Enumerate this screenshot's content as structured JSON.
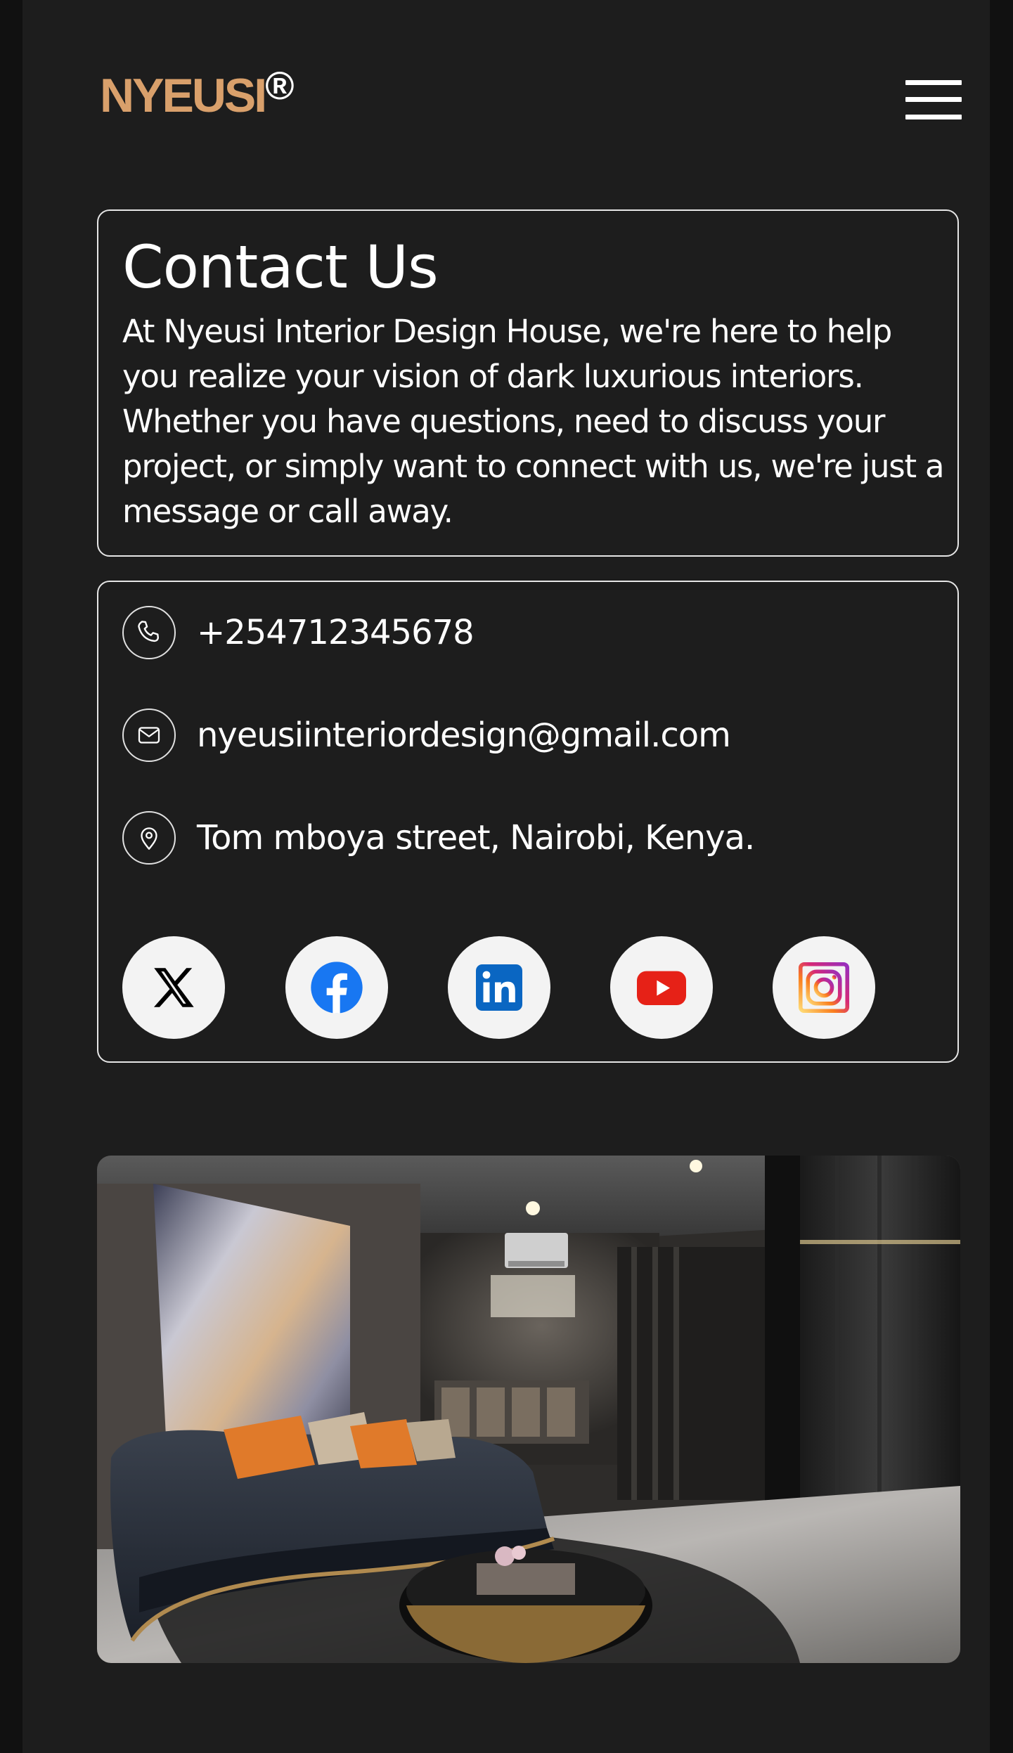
{
  "header": {
    "logo_text": "NYEUSI",
    "logo_mark": "®",
    "logo_color": "#d9a06b",
    "menu_icon": "hamburger-menu-icon"
  },
  "intro": {
    "title": "Contact Us",
    "body": "At Nyeusi Interior Design House, we're here to help you realize your vision of dark luxurious interiors. Whether you have questions, need to discuss your project, or simply want to connect with us, we're just a message or call away."
  },
  "contact": {
    "phone": {
      "icon": "phone-icon",
      "text": "+254712345678"
    },
    "email": {
      "icon": "mail-icon",
      "text": "nyeusiinteriordesign@gmail.com"
    },
    "address": {
      "icon": "location-pin-icon",
      "text": "Tom mboya street, Nairobi, Kenya."
    }
  },
  "socials": [
    {
      "name": "x-icon",
      "color": "#000000"
    },
    {
      "name": "facebook-icon",
      "color": "#1877f2"
    },
    {
      "name": "linkedin-icon",
      "color": "#0a66c2"
    },
    {
      "name": "youtube-icon",
      "color": "#e62117"
    },
    {
      "name": "instagram-icon",
      "color": "#d62976"
    }
  ],
  "colors": {
    "background": "#1d1d1d",
    "outer": "#111111",
    "accent": "#d9a06b",
    "text": "#ffffff"
  }
}
